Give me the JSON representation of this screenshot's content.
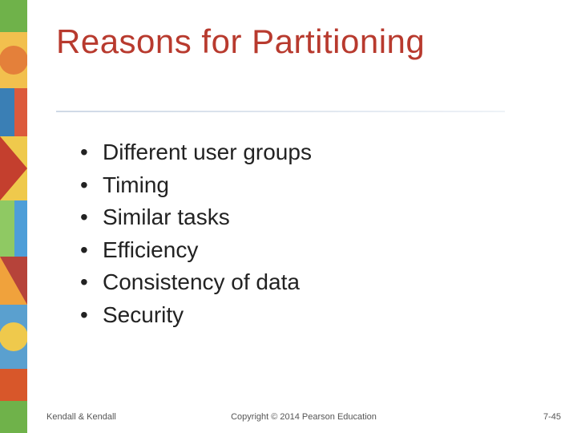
{
  "title": "Reasons for Partitioning",
  "bullets": [
    "Different user groups",
    "Timing",
    "Similar tasks",
    "Efficiency",
    "Consistency of data",
    "Security"
  ],
  "footer": {
    "left": "Kendall & Kendall",
    "center": "Copyright © 2014 Pearson Education",
    "right": "7-45"
  }
}
